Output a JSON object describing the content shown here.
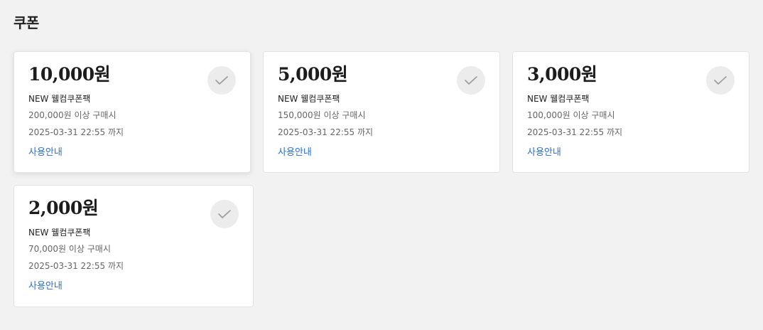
{
  "page": {
    "title": "쿠폰"
  },
  "coupons": [
    {
      "amount": "10,000원",
      "name": "NEW 웰컴쿠폰팩",
      "condition": "200,000원 이상 구매시",
      "expiry": "2025-03-31 22:55 까지",
      "guide_label": "사용안내"
    },
    {
      "amount": "5,000원",
      "name": "NEW 웰컴쿠폰팩",
      "condition": "150,000원 이상 구매시",
      "expiry": "2025-03-31 22:55 까지",
      "guide_label": "사용안내"
    },
    {
      "amount": "3,000원",
      "name": "NEW 웰컴쿠폰팩",
      "condition": "100,000원 이상 구매시",
      "expiry": "2025-03-31 22:55 까지",
      "guide_label": "사용안내"
    },
    {
      "amount": "2,000원",
      "name": "NEW 웰컴쿠폰팩",
      "condition": "70,000원 이상 구매시",
      "expiry": "2025-03-31 22:55 까지",
      "guide_label": "사용안내"
    }
  ],
  "colors": {
    "background": "#f2f2f2",
    "card": "#ffffff",
    "link": "#2a6fd6",
    "check_bg": "#ececec",
    "check_mark": "#9a9a9a"
  },
  "icons": {
    "select": "check-icon"
  }
}
